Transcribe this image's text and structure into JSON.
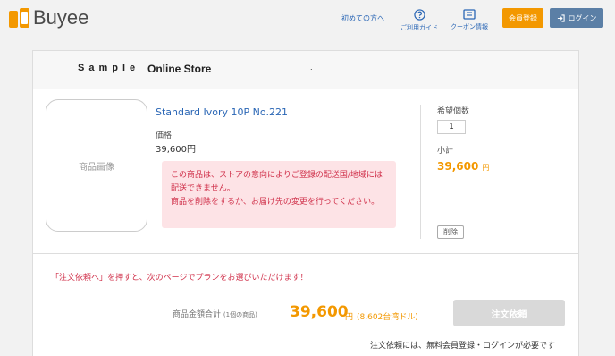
{
  "header": {
    "logo_text": "Buyee",
    "nav_first": "初めての方へ",
    "nav_guide": "ご利用ガイド",
    "nav_coupon": "クーポン情報",
    "register_label": "会員登録",
    "login_label": "ログイン"
  },
  "store": {
    "sample": "Sample",
    "name": "Online Store",
    "dot": "."
  },
  "item": {
    "image_placeholder": "商品画像",
    "name": "Standard Ivory 10P No.221",
    "price_label": "価格",
    "price_value": "39,600円",
    "warning_line1": "この商品は、ストアの意向によりご登録の配送国/地域には配送できません。",
    "warning_line2": "商品を削除をするか、お届け先の変更を行ってください。",
    "qty_label": "希望個数",
    "qty_value": "1",
    "subtotal_label": "小計",
    "subtotal_value": "39,600",
    "subtotal_unit": "円",
    "delete_label": "削除"
  },
  "summary": {
    "notice": "「注文依頼へ」を押すと、次のページでプランをお選びいただけます！",
    "total_label": "商品金額合計",
    "total_count": "(1個の商品)",
    "total_value": "39,600",
    "total_unit": "円",
    "total_twd": "(8,602台湾ドル)",
    "order_button": "注文依頼",
    "order_note": "注文依頼には、無料会員登録・ログインが必要です"
  },
  "colors": {
    "accent": "#f39800",
    "link": "#2a66b5",
    "warning": "#d0304a",
    "login_button": "#5b7fa6"
  }
}
